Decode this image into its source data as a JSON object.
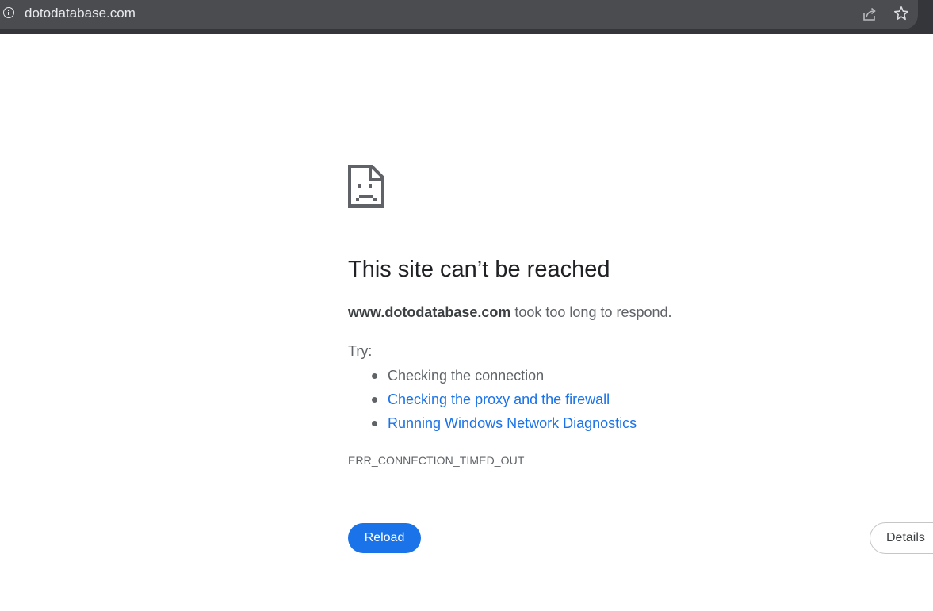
{
  "browser": {
    "url": "dotodatabase.com",
    "icons": {
      "site_info": "info-circle-icon",
      "share": "share-icon",
      "bookmark": "star-icon"
    },
    "colors": {
      "toolbar": "#35363a",
      "omnibox": "#4a4c50"
    }
  },
  "error_page": {
    "icon": "sad-page-icon",
    "title": "This site can’t be reached",
    "host": "www.dotodatabase.com",
    "message_suffix": " took too long to respond.",
    "try_label": "Try:",
    "suggestions": [
      "Checking the connection",
      "Checking the proxy and the firewall",
      "Running Windows Network Diagnostics"
    ],
    "error_code": "ERR_CONNECTION_TIMED_OUT",
    "reload_label": "Reload",
    "details_label": "Details",
    "colors": {
      "link": "#1a73e8",
      "primary_button": "#1a73e8",
      "text": "#5f6368",
      "title": "#202124"
    }
  }
}
